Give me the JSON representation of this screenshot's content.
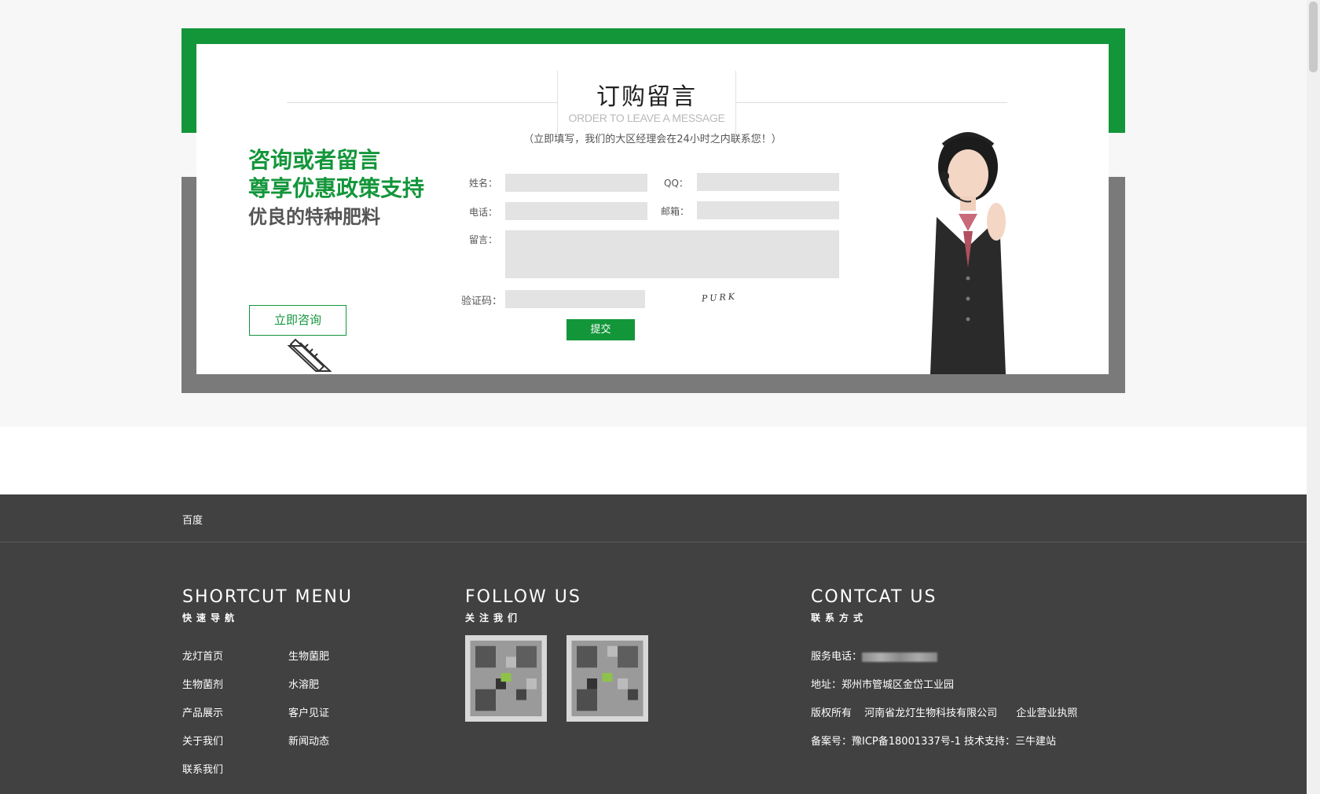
{
  "form": {
    "title_cn": "订购留言",
    "title_en": "ORDER TO LEAVE A MESSAGE",
    "subtitle": "（立即填写，我们的大区经理会在24小时之内联系您！）",
    "promo": [
      "咨询或者留言",
      "尊享优惠政策支持",
      "优良的特种肥料"
    ],
    "consult_button": "立即咨询",
    "labels": {
      "name": "姓名：",
      "qq": "QQ：",
      "phone": "电话：",
      "email": "邮箱：",
      "message": "留言：",
      "captcha": "验证码："
    },
    "captcha_text": "PURK",
    "submit": "提交"
  },
  "footer": {
    "top_link": "百度",
    "shortcut": {
      "title": "SHORTCUT MENU",
      "subtitle": "快速导航",
      "links": [
        "龙灯首页",
        "生物菌肥",
        "生物菌剂",
        "水溶肥",
        "产品展示",
        "客户见证",
        "关于我们",
        "新闻动态",
        "联系我们"
      ]
    },
    "follow": {
      "title": "FOLLOW US",
      "subtitle": "关注我们"
    },
    "contact": {
      "title": "CONTCAT US",
      "subtitle": "联系方式",
      "phone_label": "服务电话：",
      "address": "地址：郑州市管城区金岱工业园",
      "copyright_label": "版权所有",
      "company": "河南省龙灯生物科技有限公司",
      "license": "企业营业执照",
      "icp": "备案号：豫ICP备18001337号-1 技术支持：三牛建站"
    }
  },
  "colors": {
    "brand_green": "#13963a",
    "frame_gray": "#7a7a7a",
    "footer_bg": "#414141"
  }
}
